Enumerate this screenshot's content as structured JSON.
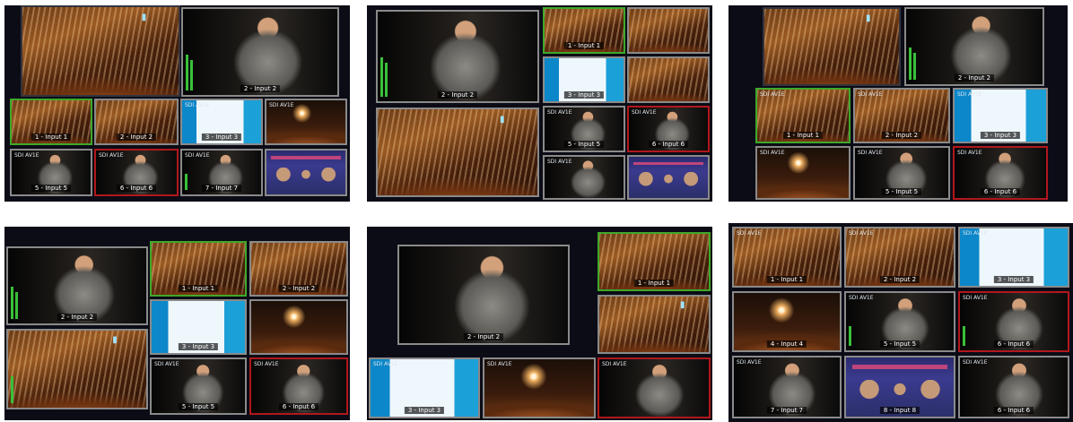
{
  "labels": {
    "input1": "1 - Input 1",
    "input2": "2 - Input 2",
    "input3": "3 - Input 3",
    "input4": "4 - Input 4",
    "input5": "5 - Input 5",
    "input6": "6 - Input 6",
    "input7": "7 - Input 7",
    "input8": "8 - Input 8",
    "tally": "SDI AV1E"
  },
  "colors": {
    "panel_bg": "#0b0c16",
    "border_green": "#3fa82a",
    "border_red": "#b0181c",
    "border_gray": "#8a8a8a",
    "audio_meter": "#39c039"
  },
  "layouts": [
    {
      "name": "layout-top-left"
    },
    {
      "name": "layout-top-center"
    },
    {
      "name": "layout-top-right"
    },
    {
      "name": "layout-bottom-left"
    },
    {
      "name": "layout-bottom-center"
    },
    {
      "name": "layout-bottom-right"
    }
  ],
  "icons": {
    "slide_icon": "bookmark-icon"
  }
}
